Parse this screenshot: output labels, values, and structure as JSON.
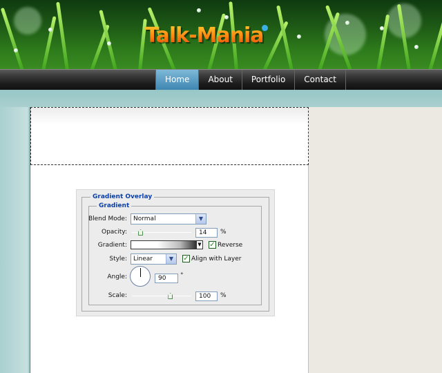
{
  "site": {
    "logo": "Talk-Mania",
    "nav": [
      {
        "label": "Home",
        "active": true
      },
      {
        "label": "About",
        "active": false
      },
      {
        "label": "Portfolio",
        "active": false
      },
      {
        "label": "Contact",
        "active": false
      }
    ]
  },
  "dialog": {
    "title": "Gradient Overlay",
    "group": "Gradient",
    "blend_mode": {
      "label": "Blend Mode:",
      "value": "Normal"
    },
    "opacity": {
      "label": "Opacity:",
      "value": "14",
      "unit": "%",
      "percent": 14
    },
    "gradient": {
      "label": "Gradient:",
      "reverse_label": "Reverse",
      "reverse_checked": true
    },
    "style": {
      "label": "Style:",
      "value": "Linear",
      "align_label": "Align with Layer",
      "align_checked": true
    },
    "angle": {
      "label": "Angle:",
      "value": "90",
      "unit": "°"
    },
    "scale": {
      "label": "Scale:",
      "value": "100",
      "unit": "%",
      "percent": 100
    }
  },
  "colors": {
    "nav_active": "#3c84b0",
    "legend_blue": "#0b3fa8",
    "logo_orange": "#f46a0c",
    "page_teal": "#a9cfcf",
    "sidebar_beige": "#ece8e2"
  }
}
